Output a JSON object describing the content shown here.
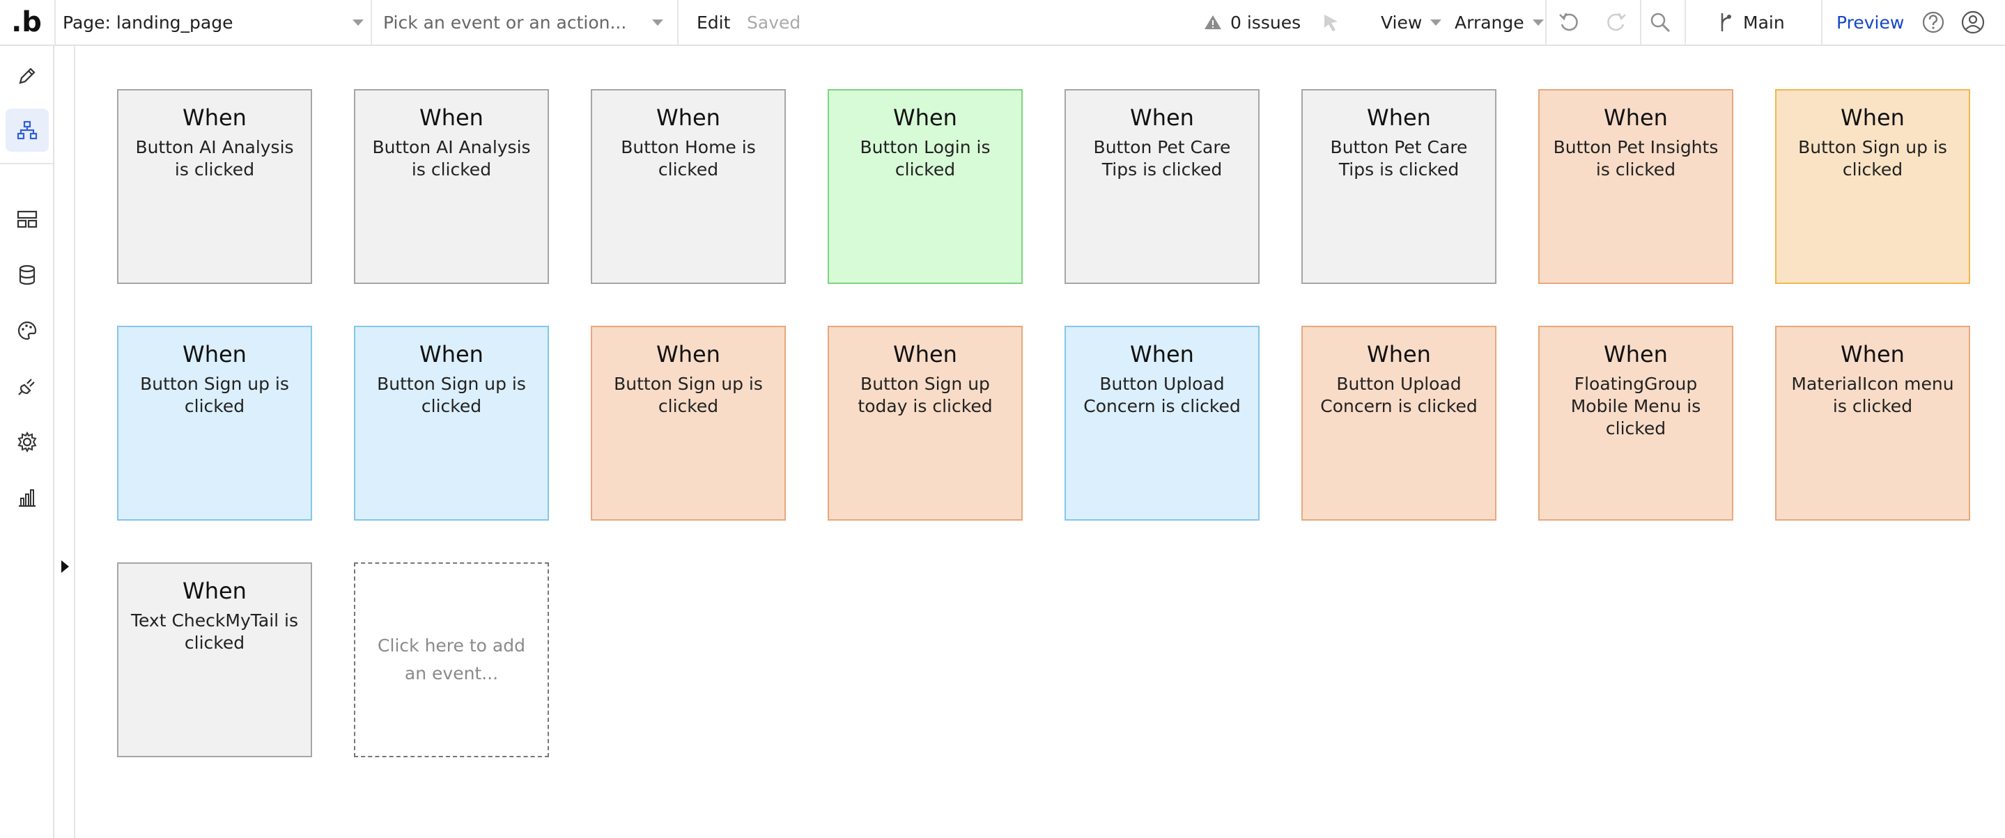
{
  "app": {
    "logo": ".b"
  },
  "toolbar": {
    "page_select": "Page: landing_page",
    "event_picker_placeholder": "Pick an event or an action...",
    "edit_label": "Edit",
    "saved_label": "Saved",
    "issues_label": "0 issues",
    "view_label": "View",
    "arrange_label": "Arrange",
    "branch_label": "Main",
    "preview_label": "Preview"
  },
  "sidebar": {
    "items": [
      {
        "name": "design",
        "icon": "pencil-icon",
        "active": false
      },
      {
        "name": "workflow",
        "icon": "workflow-icon",
        "active": true
      },
      {
        "name": "elements",
        "icon": "layout-icon",
        "active": false
      },
      {
        "name": "data",
        "icon": "database-icon",
        "active": false
      },
      {
        "name": "styles",
        "icon": "palette-icon",
        "active": false
      },
      {
        "name": "plugins",
        "icon": "plug-icon",
        "active": false
      },
      {
        "name": "settings",
        "icon": "gear-icon",
        "active": false
      },
      {
        "name": "logs",
        "icon": "bar-chart-icon",
        "active": false
      }
    ]
  },
  "colors": {
    "grey": "#f0f1f0",
    "green": "#d7fbd7",
    "orange": "#f8dcc7",
    "yellow": "#fae3c4",
    "blue": "#dbeffc",
    "accent": "#1646c8"
  },
  "events": [
    {
      "when": "When",
      "label": "Button AI Analysis is clicked",
      "color": "grey"
    },
    {
      "when": "When",
      "label": "Button AI Analysis is clicked",
      "color": "grey"
    },
    {
      "when": "When",
      "label": "Button Home is clicked",
      "color": "grey"
    },
    {
      "when": "When",
      "label": "Button Login is clicked",
      "color": "green"
    },
    {
      "when": "When",
      "label": "Button Pet Care Tips is clicked",
      "color": "grey"
    },
    {
      "when": "When",
      "label": "Button Pet Care Tips is clicked",
      "color": "grey"
    },
    {
      "when": "When",
      "label": "Button Pet Insights is clicked",
      "color": "orange"
    },
    {
      "when": "When",
      "label": "Button Sign up is clicked",
      "color": "yellow"
    },
    {
      "when": "When",
      "label": "Button Sign up is clicked",
      "color": "blue"
    },
    {
      "when": "When",
      "label": "Button Sign up is clicked",
      "color": "blue"
    },
    {
      "when": "When",
      "label": "Button Sign up is clicked",
      "color": "orange"
    },
    {
      "when": "When",
      "label": "Button Sign up today is clicked",
      "color": "orange"
    },
    {
      "when": "When",
      "label": "Button Upload Concern is clicked",
      "color": "blue"
    },
    {
      "when": "When",
      "label": "Button Upload Concern is clicked",
      "color": "orange"
    },
    {
      "when": "When",
      "label": "FloatingGroup Mobile Menu is clicked",
      "color": "orange"
    },
    {
      "when": "When",
      "label": "MaterialIcon menu is clicked",
      "color": "orange"
    },
    {
      "when": "When",
      "label": "Text CheckMyTail is clicked",
      "color": "grey"
    }
  ],
  "add_event_label": "Click here to add an event..."
}
